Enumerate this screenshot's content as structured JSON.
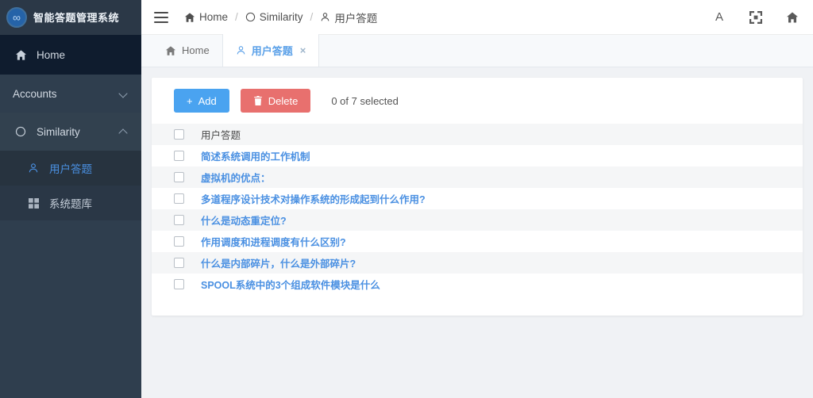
{
  "brand": {
    "logo_icon": "infinity-circle-icon",
    "logo_glyph": "∞",
    "title": "智能答题管理系统"
  },
  "sidebar": {
    "items": [
      {
        "label": "Home",
        "icon": "home-icon",
        "active": true,
        "has_chevron": false
      },
      {
        "label": "Accounts",
        "icon": "none",
        "active": false,
        "has_chevron": true,
        "chevron": "chevron-down-icon"
      },
      {
        "label": "Similarity",
        "icon": "circle-icon",
        "active": false,
        "has_chevron": true,
        "chevron": "chevron-up-icon"
      }
    ],
    "subitems": [
      {
        "label": "用户答题",
        "icon": "user-icon",
        "active": true
      },
      {
        "label": "系统题库",
        "icon": "grid-icon",
        "active": false
      }
    ]
  },
  "topbar": {
    "menu_icon": "hamburger-icon",
    "breadcrumb": [
      {
        "label": "Home",
        "icon": "home-icon"
      },
      {
        "label": "Similarity",
        "icon": "circle-icon"
      },
      {
        "label": "用户答题",
        "icon": "user-icon"
      }
    ],
    "separator": "/",
    "actions": [
      {
        "name": "font-size-button",
        "glyph": "A"
      },
      {
        "name": "fullscreen-button",
        "glyph": "fullscreen-icon"
      },
      {
        "name": "home-button",
        "glyph": "home-icon"
      }
    ]
  },
  "tabs": [
    {
      "label": "Home",
      "icon": "home-icon",
      "active": false,
      "closable": false
    },
    {
      "label": "用户答题",
      "icon": "user-icon",
      "active": true,
      "closable": true,
      "close_glyph": "×"
    }
  ],
  "toolbar": {
    "add_label": "Add",
    "add_icon": "plus-icon",
    "delete_label": "Delete",
    "delete_icon": "trash-icon",
    "selection_text": "0 of 7 selected"
  },
  "table": {
    "column_header": "用户答题",
    "rows": [
      {
        "text": "简述系统调用的工作机制"
      },
      {
        "text": "虚拟机的优点："
      },
      {
        "text": "多道程序设计技术对操作系统的形成起到什么作用?"
      },
      {
        "text": "什么是动态重定位?"
      },
      {
        "text": "作用调度和进程调度有什么区别?"
      },
      {
        "text": "什么是内部碎片，什么是外部碎片?"
      },
      {
        "text": "SPOOL系统中的3个组成软件模块是什么"
      }
    ]
  },
  "colors": {
    "sidebar_bg": "#2f3e4e",
    "sidebar_active_bg": "#0f1c2e",
    "accent_blue": "#4a90e2",
    "button_add": "#4aa3f0",
    "button_delete": "#e8706e",
    "page_bg": "#f0f2f5"
  }
}
